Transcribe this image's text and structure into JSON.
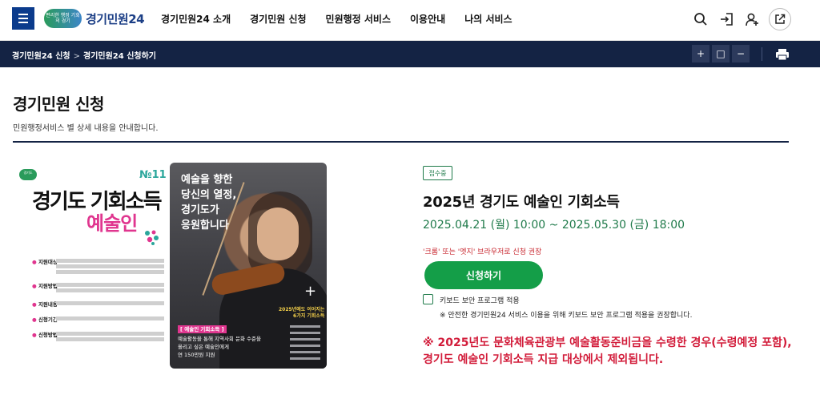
{
  "header": {
    "logo_badge": "편리한 행정 기회의 경기",
    "logo_text": "경기민원24",
    "nav": [
      "경기민원24 소개",
      "경기민원 신청",
      "민원행정 서비스",
      "이용안내",
      "나의 서비스"
    ],
    "icons": [
      "menu-icon",
      "search-icon",
      "login-icon",
      "user-add-icon",
      "external-link-icon"
    ]
  },
  "breadcrumb": {
    "items": [
      "경기민원24 신청",
      "경기민원24 신청하기"
    ],
    "separator": ">",
    "buttons": [
      "+",
      "□",
      "−"
    ],
    "print_icon": "printer-icon"
  },
  "page": {
    "title": "경기민원 신청",
    "description": "민원행정서비스 별 상세 내용을 안내합니다."
  },
  "poster": {
    "badge": "경기도",
    "number": "№11",
    "title_line1": "경기도 기회소득",
    "title_line2": "예술인",
    "rows": [
      {
        "key": "지원대상",
        "value": "도내 거주 예술활동증명 완료자 중 개인소득 인정액 기준,"
      },
      {
        "key": "지원방법",
        "value": "현금지급 (1차 지급: 6~7월 중 / 2차 지급: 9월 중)"
      },
      {
        "key": "지원내용",
        "value": "연 150만원 지원 (2회, 각 75만원)"
      },
      {
        "key": "신청기간",
        "value": "2025. 4.21.(월) 10시 ~ 5.30.(금) 18시"
      },
      {
        "key": "신청방법",
        "value": "경기민원24 (gg24.gg.go.kr)"
      }
    ],
    "right_text": [
      "예술을 향한",
      "당신의 열정,",
      "경기도가",
      "응원합니다"
    ],
    "right_yellow": [
      "2025년에도 이어지는",
      "6가지 기회소득"
    ],
    "right_tag": "[ 예술인 기회소득 ]",
    "right_desc": [
      "예술활동을 통해 지역사회 문화 수준을",
      "올리고 싶은 예술인에게",
      "연 150만원 지원"
    ]
  },
  "info": {
    "status": "접수중",
    "title": "2025년 경기도 예술인 기회소득",
    "date": "2025.04.21 (월) 10:00 ~ 2025.05.30 (금) 18:00",
    "browser_note": "'크롬' 또는 '엣지' 브라우저로 신청 권장",
    "apply_label": "신청하기",
    "checkbox_label": "키보드 보안 프로그램 적용",
    "checkbox_note": "※ 안전한 경기민원24 서비스 이용을 위해 키보드 보안 프로그램 적용을 권장합니다.",
    "warning": "※ 2025년도 문화체육관광부 예술활동준비금을 수령한 경우(수령예정 포함), 경기도 예술인 기회소득 지급 대상에서 제외됩니다."
  },
  "colors": {
    "navy": "#142344",
    "brand_blue": "#0b3b8c",
    "green": "#149e48",
    "red": "#d21c3a",
    "pink": "#e0368f"
  }
}
